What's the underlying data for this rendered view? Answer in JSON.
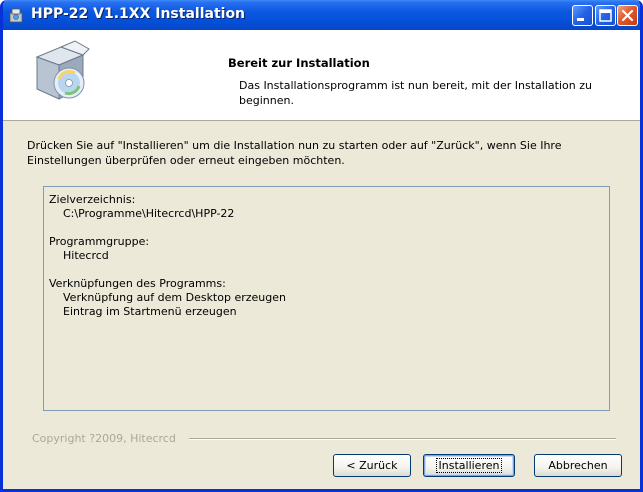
{
  "window": {
    "title": "HPP-22 V1.1XX Installation"
  },
  "header": {
    "title": "Bereit zur Installation",
    "description": "Das Installationsprogramm ist nun bereit, mit der Installation zu beginnen."
  },
  "main": {
    "intro": "Drücken Sie auf \"Installieren\" um die Installation nun zu starten oder auf \"Zurück\", wenn Sie Ihre Einstellungen überprüfen oder erneut eingeben möchten.",
    "memo": {
      "dest_label": "Zielverzeichnis:",
      "dest_value": "C:\\Programme\\Hitecrcd\\HPP-22",
      "group_label": "Programmgruppe:",
      "group_value": "Hitecrcd",
      "shortcuts_label": "Verknüpfungen des Programms:",
      "shortcut_desktop": "Verknüpfung auf dem Desktop erzeugen",
      "shortcut_start": "Eintrag im Startmenü erzeugen"
    }
  },
  "footer": {
    "copyright": "Copyright ?2009, Hitecrcd",
    "back_label": "< Zurück",
    "install_label": "Installieren",
    "cancel_label": "Abbrechen"
  },
  "colors": {
    "titlebar": "#0a58e0",
    "dialog_bg": "#ece9d8",
    "close_button": "#e05a2b"
  }
}
